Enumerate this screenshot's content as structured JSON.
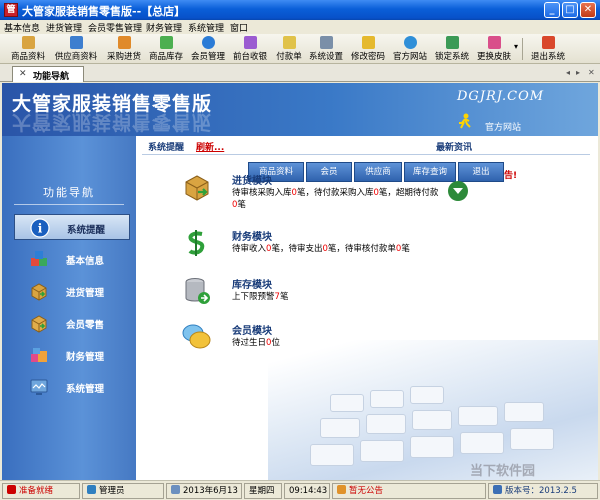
{
  "window": {
    "title": "大管家服装销售零售版--【总店】",
    "minimize": "_",
    "maximize": "□",
    "close": "✕"
  },
  "menu": [
    "基本信息",
    "进货管理",
    "会员零售管理",
    "财务管理",
    "系统管理",
    "窗口"
  ],
  "toolbar": {
    "buttons": [
      "商品资料",
      "供应商资料",
      "采购进货",
      "商品库存",
      "会员管理",
      "前台收银",
      "付款单",
      "系统设置",
      "修改密码",
      "官方网站",
      "锁定系统",
      "更换皮肤",
      "退出系统"
    ],
    "more_glyph": "▾"
  },
  "tab": {
    "close_glyph": "✕",
    "label": "功能导航",
    "nav_left": "◂",
    "nav_right": "▸",
    "nav_close": "✕"
  },
  "banner": {
    "title": "大管家服装销售零售版",
    "domain": "DGJRJ.COM",
    "site_label": "官方网站"
  },
  "sidebar": {
    "heading": "功能导航",
    "items": [
      {
        "label": "系统提醒",
        "icon": "info-icon",
        "active": true
      },
      {
        "label": "基本信息",
        "icon": "blocks-icon",
        "active": false
      },
      {
        "label": "进货管理",
        "icon": "box-icon",
        "active": false
      },
      {
        "label": "会员零售",
        "icon": "box-icon",
        "active": false
      },
      {
        "label": "财务管理",
        "icon": "gifts-icon",
        "active": false
      },
      {
        "label": "系统管理",
        "icon": "monitor-icon",
        "active": false
      }
    ]
  },
  "main": {
    "remind_label": "系统提醒",
    "refresh_label": "刷新...",
    "news_label": "最新资讯",
    "quick_buttons": [
      "商品资料",
      "会员",
      "供应商",
      "库存查询",
      "退出"
    ],
    "news_tail": "告!",
    "modules": [
      {
        "title": "进货模块",
        "icon": "box-arrow-icon",
        "parts": [
          "待审核采购入库",
          "0",
          "笔，待付款采购入库",
          "0",
          "笔，超期待付款",
          "0",
          "笔"
        ]
      },
      {
        "title": "财务模块",
        "icon": "dollar-icon",
        "parts": [
          "待审收入",
          "0",
          "笔，待审支出",
          "0",
          "笔，待审核付款单",
          "0",
          "笔"
        ]
      },
      {
        "title": "库存模块",
        "icon": "database-icon",
        "parts": [
          "上下限预警",
          "7",
          "笔"
        ]
      },
      {
        "title": "会员模块",
        "icon": "chat-bubble-icon",
        "parts": [
          "待过生日",
          "0",
          "位"
        ]
      }
    ]
  },
  "status": {
    "ready": "准备就绪",
    "user": "管理员",
    "date": "2013年6月13日",
    "weekday": "星期四",
    "time": "09:14:43",
    "notice": "暂无公告",
    "version": "版本号：2013.2.5"
  },
  "watermark": "当下软件园",
  "colors": {
    "title_blue": "#0a5fd8",
    "sidebar_blue": "#4679c3",
    "alert_red": "#e00000",
    "module_title": "#1a3d7a"
  }
}
